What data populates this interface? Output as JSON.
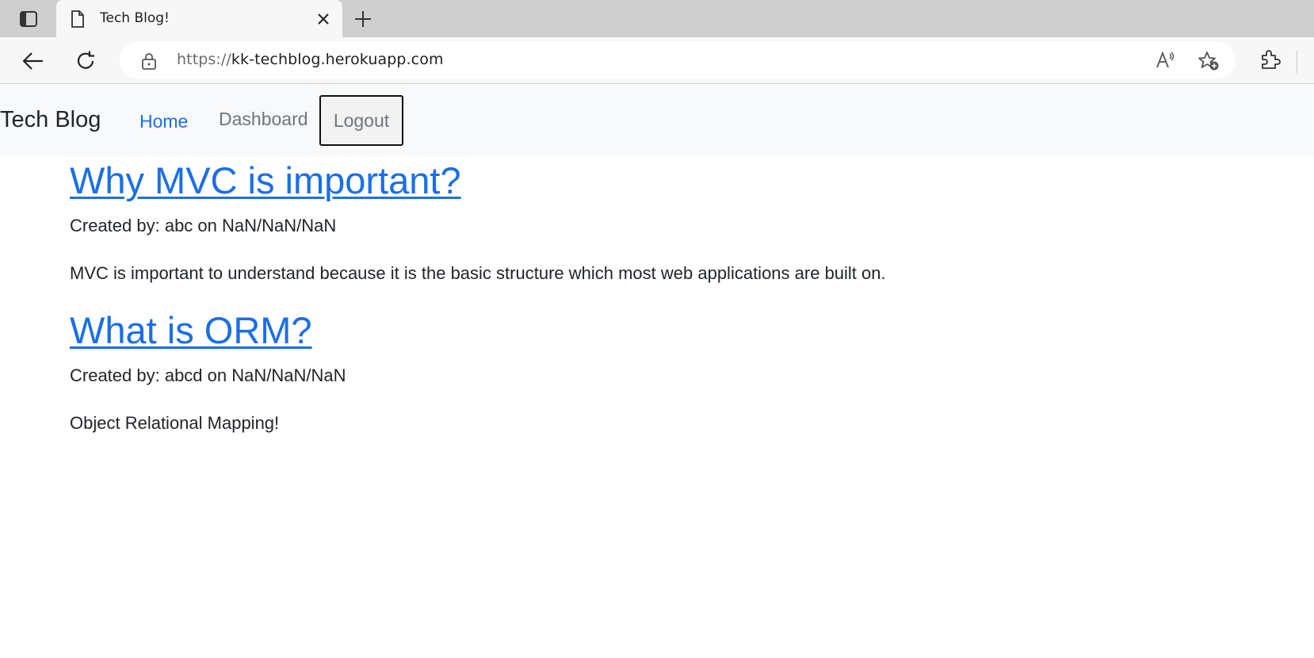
{
  "browser": {
    "tab_title": "Tech Blog!",
    "url_scheme": "https://",
    "url_host": "kk-techblog.herokuapp.com",
    "icons": {
      "tab_actions": "tab-actions-icon",
      "page": "page-icon",
      "close": "close-icon",
      "new_tab": "plus-icon",
      "back": "back-arrow-icon",
      "reload": "reload-icon",
      "lock": "lock-icon",
      "read_aloud": "read-aloud-icon",
      "favorites": "add-favorite-icon",
      "extensions": "extensions-icon"
    }
  },
  "site": {
    "brand": "Tech Blog",
    "nav": {
      "home": "Home",
      "dashboard": "Dashboard",
      "logout": "Logout"
    },
    "colors": {
      "link": "#1a6fe8",
      "muted": "#6c757d",
      "text": "#212529",
      "nav_bg": "#f8f9fa"
    }
  },
  "posts": [
    {
      "title": "Why MVC is important?",
      "meta": "Created by: abc on NaN/NaN/NaN",
      "body": "MVC is important to understand because it is the basic structure which most web applications are built on."
    },
    {
      "title": "What is ORM?",
      "meta": "Created by: abcd on NaN/NaN/NaN",
      "body": "Object Relational Mapping!"
    }
  ]
}
